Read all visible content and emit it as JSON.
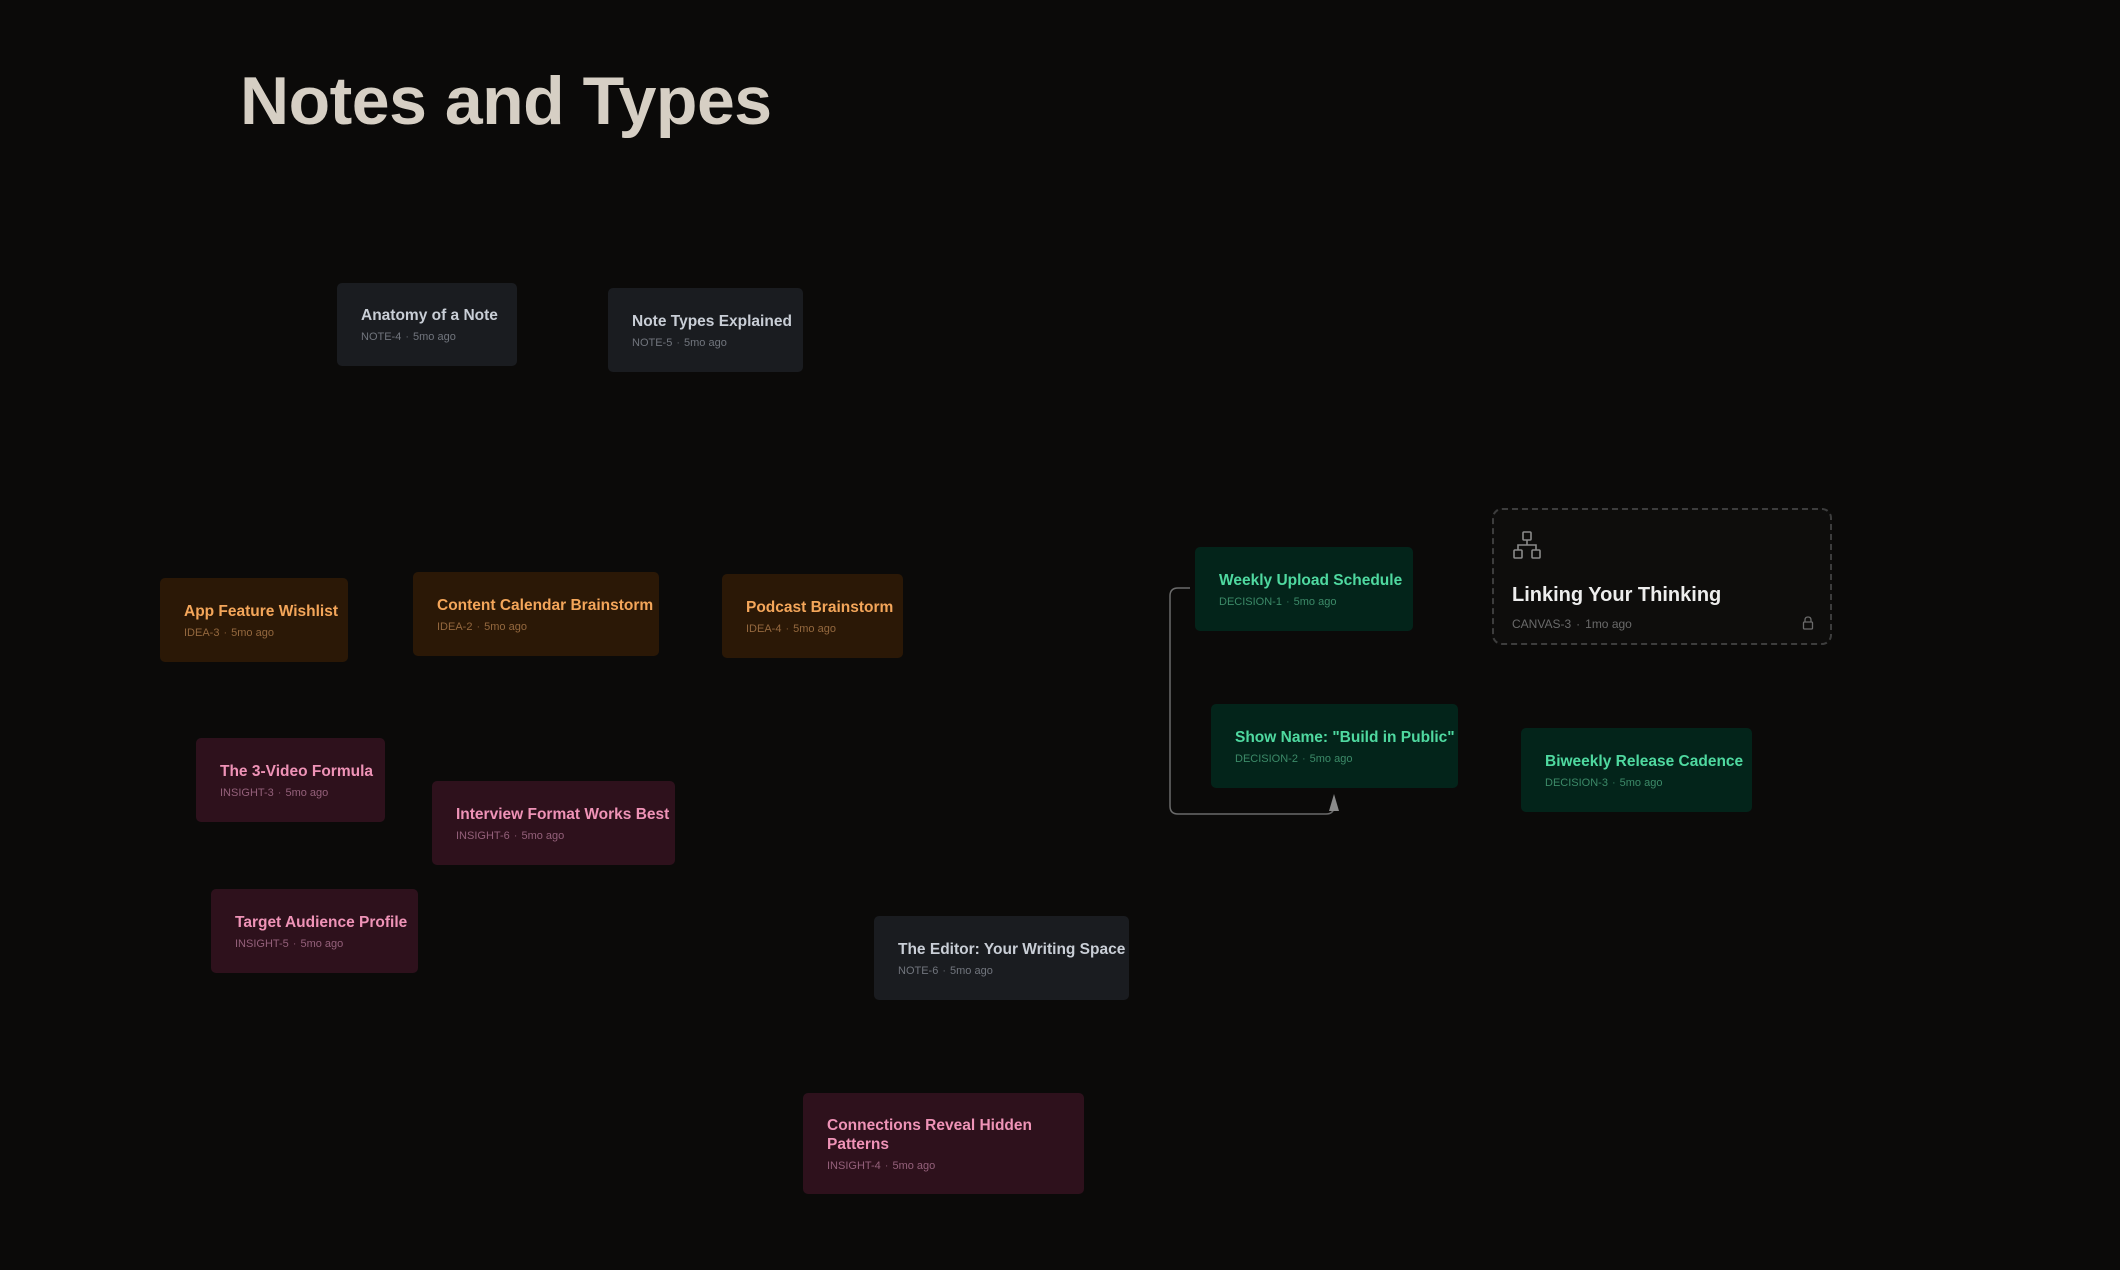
{
  "page": {
    "title": "Notes and Types"
  },
  "cards": [
    {
      "id": "note-4",
      "type": "note",
      "title": "Anatomy of a Note",
      "code": "NOTE-4",
      "age": "5mo ago"
    },
    {
      "id": "note-5",
      "type": "note",
      "title": "Note Types Explained",
      "code": "NOTE-5",
      "age": "5mo ago"
    },
    {
      "id": "idea-3",
      "type": "idea",
      "title": "App Feature Wishlist",
      "code": "IDEA-3",
      "age": "5mo ago"
    },
    {
      "id": "idea-2",
      "type": "idea",
      "title": "Content Calendar Brainstorm",
      "code": "IDEA-2",
      "age": "5mo ago"
    },
    {
      "id": "idea-4",
      "type": "idea",
      "title": "Podcast Brainstorm",
      "code": "IDEA-4",
      "age": "5mo ago"
    },
    {
      "id": "decision-1",
      "type": "decision",
      "title": "Weekly Upload Schedule",
      "code": "DECISION-1",
      "age": "5mo ago"
    },
    {
      "id": "decision-2",
      "type": "decision",
      "title": "Show Name: \"Build in Public\"",
      "code": "DECISION-2",
      "age": "5mo ago"
    },
    {
      "id": "decision-3",
      "type": "decision",
      "title": "Biweekly Release Cadence",
      "code": "DECISION-3",
      "age": "5mo ago"
    },
    {
      "id": "insight-3",
      "type": "insight",
      "title": "The 3-Video Formula",
      "code": "INSIGHT-3",
      "age": "5mo ago"
    },
    {
      "id": "insight-6",
      "type": "insight",
      "title": "Interview Format Works Best",
      "code": "INSIGHT-6",
      "age": "5mo ago"
    },
    {
      "id": "insight-5",
      "type": "insight",
      "title": "Target Audience Profile",
      "code": "INSIGHT-5",
      "age": "5mo ago"
    },
    {
      "id": "note-6",
      "type": "note",
      "title": "The Editor: Your Writing Space",
      "code": "NOTE-6",
      "age": "5mo ago"
    },
    {
      "id": "insight-4",
      "type": "insight",
      "title": "Connections Reveal Hidden Patterns",
      "code": "INSIGHT-4",
      "age": "5mo ago"
    }
  ],
  "canvas_card": {
    "title": "Linking Your Thinking",
    "code": "CANVAS-3",
    "age": "1mo ago",
    "icon": "hierarchy-icon",
    "lock_icon": "lock-icon"
  },
  "meta_separator": "·",
  "connector": {
    "from": "decision-1",
    "to": "decision-2",
    "color": "#6b6b6b"
  },
  "colors": {
    "background": "#0b0a09",
    "note": "#1a1c20",
    "idea": "#2b1806",
    "insight": "#2e111c",
    "decision": "#03241a"
  }
}
